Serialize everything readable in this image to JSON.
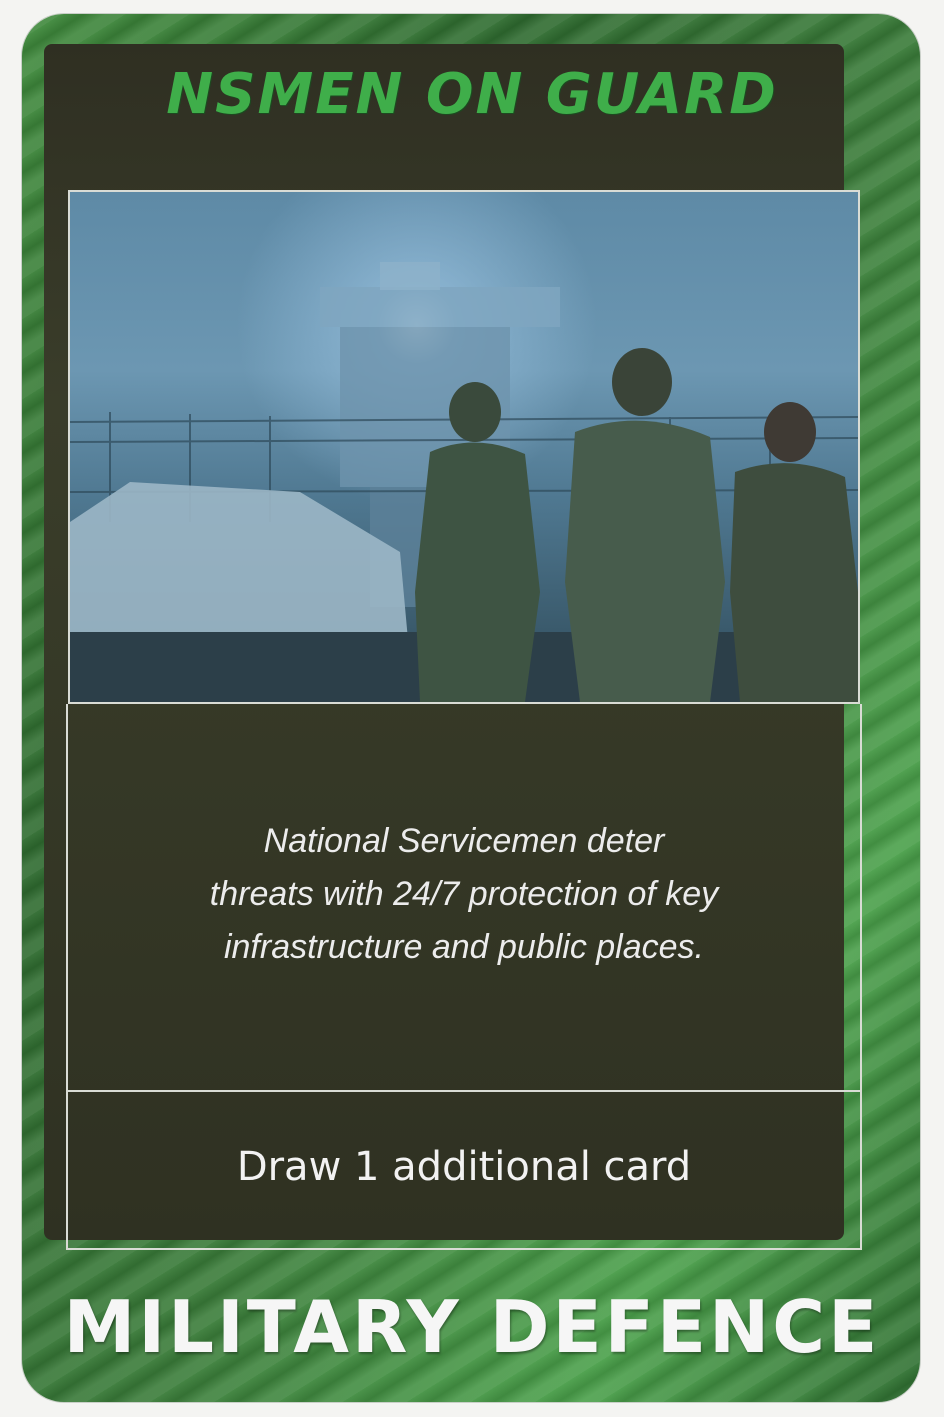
{
  "card": {
    "title": "NSMEN ON GUARD",
    "flavor_lines": [
      "National Servicemen deter",
      "threats with 24/7 protection of key",
      "infrastructure and public places."
    ],
    "effect": "Draw 1 additional card",
    "category": "MILITARY DEFENCE"
  },
  "colors": {
    "card_border": "#3a7c39",
    "title": "#3fae4a",
    "panel": "#353826",
    "text": "#ececec"
  }
}
